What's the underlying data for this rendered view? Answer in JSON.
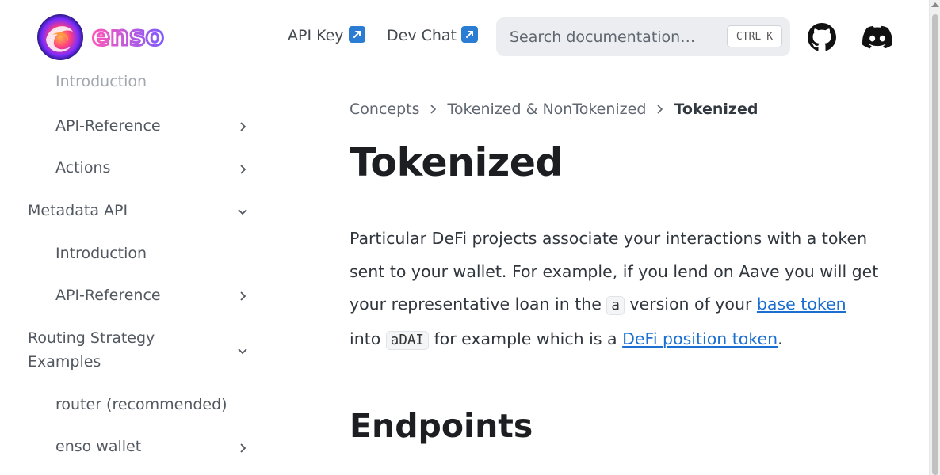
{
  "brand": {
    "name": "enso"
  },
  "navbar": {
    "links": [
      {
        "label": "API Key",
        "icon": "external-link-icon"
      },
      {
        "label": "Dev Chat",
        "icon": "external-link-icon"
      }
    ],
    "search": {
      "placeholder": "Search documentation…",
      "kbd_ctrl": "CTRL",
      "kbd_key": "K"
    },
    "icons": [
      "github-icon",
      "discord-icon"
    ]
  },
  "sidebar": {
    "items": [
      {
        "label": "Introduction",
        "state": "partially-scrolled-out"
      },
      {
        "label": "API-Reference",
        "collapsed": true
      },
      {
        "label": "Actions",
        "collapsed": true
      },
      {
        "label": "Metadata API",
        "expanded": true
      },
      {
        "label": "Introduction"
      },
      {
        "label": "API-Reference",
        "collapsed": true
      },
      {
        "label_line1": "Routing Strategy",
        "label_line2": "Examples",
        "expanded": true
      },
      {
        "label": "router (recommended)"
      },
      {
        "label": "enso wallet",
        "collapsed": true
      }
    ]
  },
  "breadcrumbs": [
    "Concepts",
    "Tokenized & NonTokenized",
    "Tokenized"
  ],
  "page": {
    "title": "Tokenized",
    "paragraph": {
      "t1": "Particular DeFi projects associate your interactions with a token sent to your wallet. For example, if you lend on Aave you will get your representative loan in the ",
      "code1": "a",
      "t2": " version of your ",
      "link1": "base token",
      "t3": " into ",
      "code2": "aDAI",
      "t4": " for example which is a ",
      "link2": "DeFi position token",
      "t5": "."
    },
    "section_heading": "Endpoints"
  },
  "colors": {
    "link": "#1a6fd0",
    "text": "#1c1e21",
    "muted": "#525860",
    "search_bg": "#ebedf0"
  }
}
